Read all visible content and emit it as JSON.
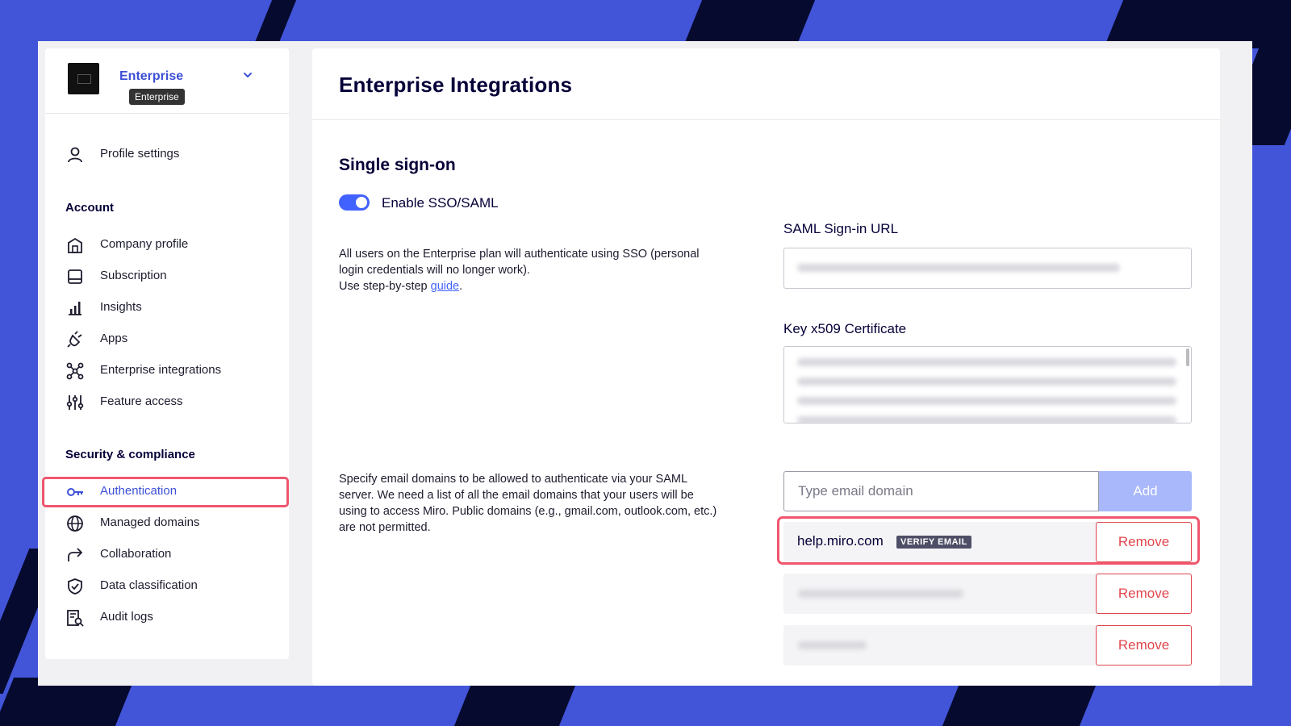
{
  "colors": {
    "background_blue": "#4255d9",
    "stripe_navy": "#060a2e",
    "accent_blue": "#4262ff",
    "highlight_pink": "#f0566e",
    "remove_red": "#e0474e"
  },
  "org": {
    "name": "Enterprise",
    "tooltip": "Enterprise",
    "dropdown_icon": "chevron-down-icon"
  },
  "sidebar": {
    "profile": {
      "label": "Profile settings",
      "icon": "user-icon"
    },
    "account_title": "Account",
    "account_items": [
      {
        "label": "Company profile",
        "icon": "building-icon"
      },
      {
        "label": "Subscription",
        "icon": "subscription-icon"
      },
      {
        "label": "Insights",
        "icon": "bar-chart-icon"
      },
      {
        "label": "Apps",
        "icon": "plug-icon"
      },
      {
        "label": "Enterprise integrations",
        "icon": "integrations-icon"
      },
      {
        "label": "Feature access",
        "icon": "sliders-icon"
      }
    ],
    "security_title": "Security & compliance",
    "security_items": [
      {
        "label": "Authentication",
        "icon": "key-icon",
        "active": true
      },
      {
        "label": "Managed domains",
        "icon": "globe-icon"
      },
      {
        "label": "Collaboration",
        "icon": "share-arrow-icon"
      },
      {
        "label": "Data classification",
        "icon": "shield-icon"
      },
      {
        "label": "Audit logs",
        "icon": "audit-log-icon"
      }
    ]
  },
  "main": {
    "title": "Enterprise Integrations",
    "sso": {
      "title": "Single sign-on",
      "toggle_label": "Enable SSO/SAML",
      "toggle_on": true,
      "desc_line1": "All users on the Enterprise plan will authenticate using SSO (personal",
      "desc_line2": "login credentials will no longer work).",
      "desc_line3_prefix": "Use step-by-step ",
      "guide_link": "guide",
      "desc_line3_suffix": ".",
      "saml_url_label": "SAML Sign-in URL",
      "cert_label": "Key x509 Certificate"
    },
    "domains": {
      "desc_line1": "Specify email domains to be allowed to authenticate via your SAML",
      "desc_line2": "server. We need a list of all the email domains that your users will be",
      "desc_line3": "using to access Miro. Public domains (e.g., gmail.com, outlook.com, etc.)",
      "desc_line4": "are not permitted.",
      "input_placeholder": "Type email domain",
      "add_label": "Add",
      "rows": [
        {
          "domain": "help.miro.com",
          "badge": "VERIFY EMAIL",
          "remove_label": "Remove"
        },
        {
          "domain": "",
          "remove_label": "Remove"
        },
        {
          "domain": "",
          "remove_label": "Remove"
        }
      ]
    }
  }
}
